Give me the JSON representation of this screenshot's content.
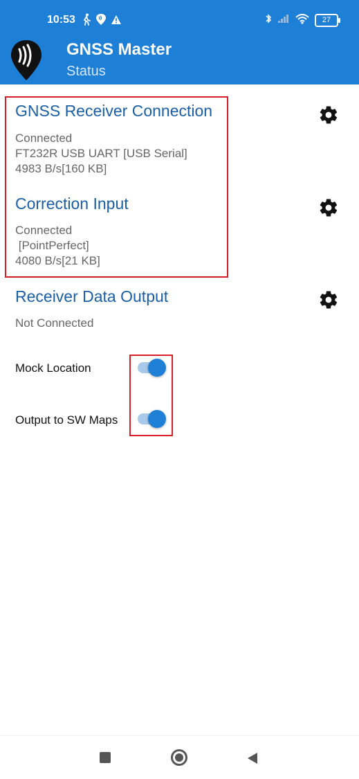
{
  "status_bar": {
    "time": "10:53",
    "battery": "27"
  },
  "app_bar": {
    "title": "GNSS Master",
    "subtitle": "Status",
    "color": "#1e7fd6"
  },
  "sections": {
    "gnss_receiver": {
      "title": "GNSS Receiver Connection",
      "lines": [
        "Connected",
        "FT232R USB UART [USB Serial]",
        "4983 B/s[160 KB]"
      ]
    },
    "correction_input": {
      "title": "Correction Input",
      "lines": [
        "Connected",
        " [PointPerfect]",
        "4080 B/s[21 KB]"
      ]
    },
    "receiver_output": {
      "title": "Receiver Data Output",
      "lines": [
        "Not Connected"
      ]
    }
  },
  "toggles": {
    "mock_location": {
      "label": "Mock Location",
      "on": true
    },
    "output_sw_maps": {
      "label": "Output to SW Maps",
      "on": true
    }
  },
  "icons": [
    "walk-icon",
    "app-notification-icon",
    "warning-icon",
    "bluetooth-icon",
    "signal-icon",
    "wifi-icon",
    "battery-icon",
    "gear-icon",
    "gnss-logo-icon"
  ],
  "colors": {
    "accent": "#1e7fd6",
    "section_title": "#1a5fa6",
    "highlight": "#d91e2a"
  }
}
